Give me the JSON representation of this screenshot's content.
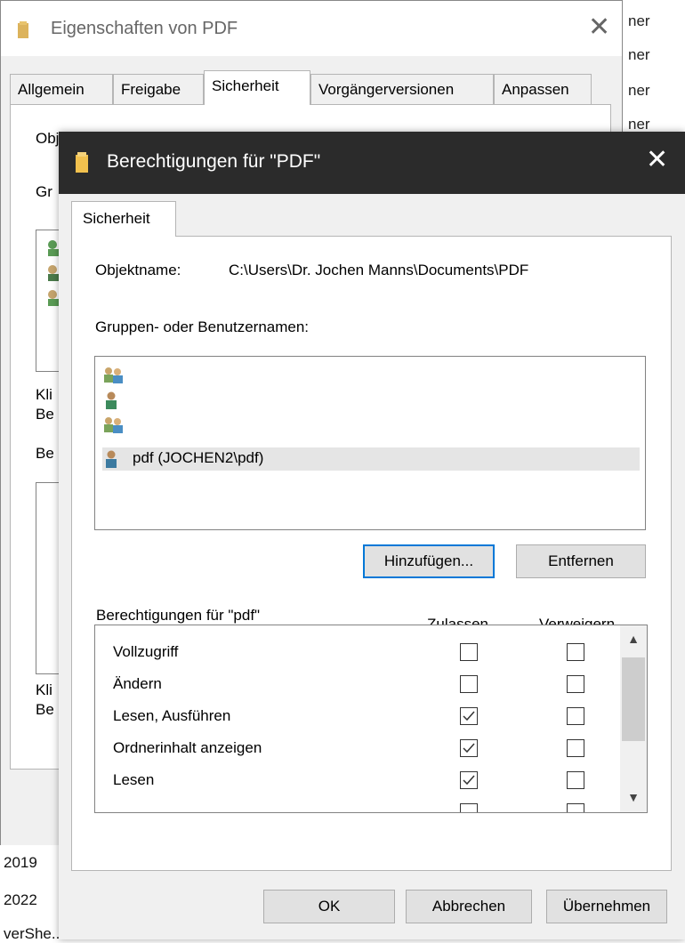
{
  "background": {
    "right_fragments": [
      "ner",
      "ner",
      "ner",
      "ner"
    ],
    "bottom_fragments": [
      "2019",
      "2022",
      "verShe..."
    ]
  },
  "back_dialog": {
    "title": "Eigenschaften von PDF",
    "tabs": [
      "Allgemein",
      "Freigabe",
      "Sicherheit",
      "Vorgängerversionen",
      "Anpassen"
    ],
    "active_tab": "Sicherheit",
    "fragments": [
      "Obj",
      "Gr",
      "Kli",
      "Be",
      "Be",
      "Kli",
      "Be"
    ]
  },
  "front_dialog": {
    "title": "Berechtigungen für \"PDF\"",
    "tab": "Sicherheit",
    "object_label": "Objektname:",
    "object_value": "C:\\Users\\Dr. Jochen Manns\\Documents\\PDF",
    "groups_label": "Gruppen- oder Benutzernamen:",
    "users": [
      {
        "name": "",
        "icon": "group-users-icon",
        "selected": false
      },
      {
        "name": "",
        "icon": "user-icon",
        "selected": false
      },
      {
        "name": "",
        "icon": "group-users-icon",
        "selected": false
      },
      {
        "name": "pdf (JOCHEN2\\pdf)",
        "icon": "user-icon",
        "selected": true
      }
    ],
    "add_button": "Hinzufügen...",
    "remove_button": "Entfernen",
    "perm_label": "Berechtigungen für \"pdf\"",
    "allow_header": "Zulassen",
    "deny_header": "Verweigern",
    "permissions": [
      {
        "name": "Vollzugriff",
        "allow": false,
        "deny": false
      },
      {
        "name": "Ändern",
        "allow": false,
        "deny": false
      },
      {
        "name": "Lesen, Ausführen",
        "allow": true,
        "deny": false
      },
      {
        "name": "Ordnerinhalt anzeigen",
        "allow": true,
        "deny": false
      },
      {
        "name": "Lesen",
        "allow": true,
        "deny": false
      }
    ],
    "ok_button": "OK",
    "cancel_button": "Abbrechen",
    "apply_button": "Übernehmen"
  }
}
